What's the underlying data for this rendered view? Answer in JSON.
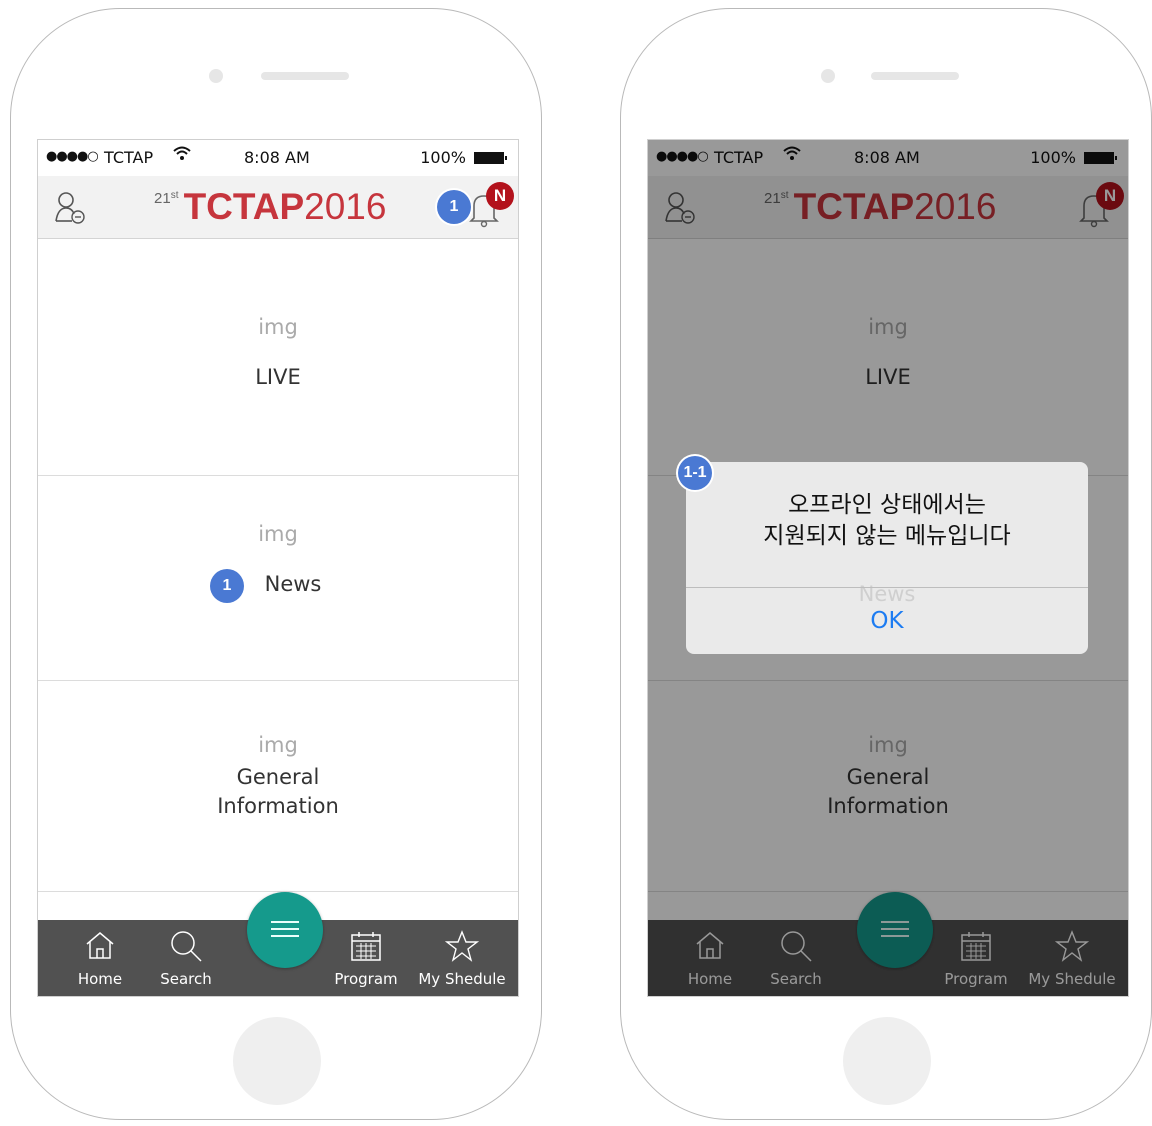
{
  "statusbar": {
    "signal": "●●●●○",
    "carrier": "TCTAP",
    "time": "8:08 AM",
    "battery": "100%"
  },
  "navbar": {
    "logo_ordinal": "21",
    "logo_suffix": "st",
    "logo_brand": "TCTAP",
    "logo_year": "2016",
    "notification_badge": "N"
  },
  "menu": [
    {
      "img": "img",
      "label": "LIVE"
    },
    {
      "img": "img",
      "label": "News"
    },
    {
      "img": "img",
      "label_line1": "General",
      "label_line2": "Information"
    }
  ],
  "tabbar": {
    "home": "Home",
    "search": "Search",
    "program": "Program",
    "myschedule": "My Shedule"
  },
  "markers": {
    "bell": "1",
    "news": "1",
    "dialog": "1-1"
  },
  "dialog": {
    "line1": "오프라인 상태에서는",
    "line2": "지원되지 않는 메뉴입니다",
    "ok": "OK"
  },
  "colors": {
    "brand": "#c6353d",
    "fab": "#159a8c",
    "badge": "#b3121c",
    "marker": "#4a79d3",
    "tabbar": "#515151",
    "dialog_ok": "#1d7cf2"
  }
}
